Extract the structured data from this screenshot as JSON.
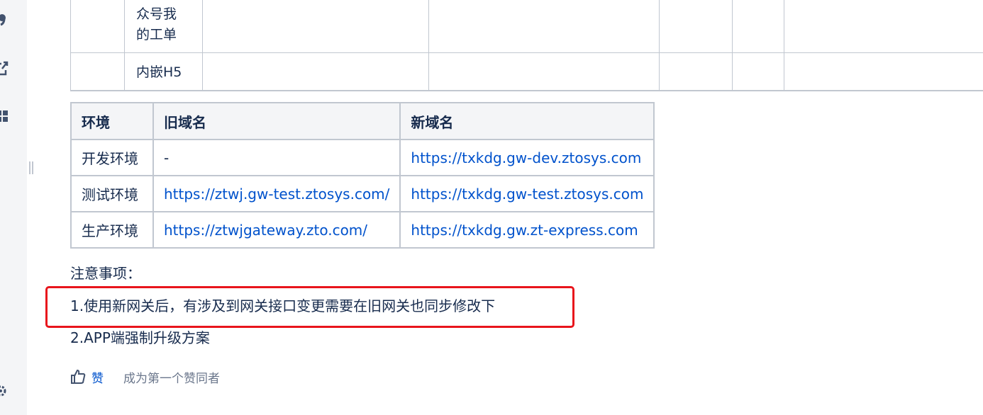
{
  "sidebar": {
    "icons": [
      "quote-icon",
      "share-icon",
      "apps-icon",
      "settings-icon"
    ]
  },
  "top_table": {
    "rows": [
      {
        "label": "众号我\n的工单"
      },
      {
        "label": "内嵌H5"
      }
    ]
  },
  "domain_table": {
    "headers": [
      "环境",
      "旧域名",
      "新域名"
    ],
    "rows": [
      {
        "env": "开发环境",
        "old": "-",
        "new": "https://txkdg.gw-dev.ztosys.com"
      },
      {
        "env": "测试环境",
        "old": "https://ztwj.gw-test.ztosys.com/",
        "new": "https://txkdg.gw-test.ztosys.com"
      },
      {
        "env": "生产环境",
        "old": "https://ztwjgateway.zto.com/",
        "new": "https://txkdg.gw.zt-express.com"
      }
    ]
  },
  "notes": {
    "title": "注意事项：",
    "items": [
      "1.使用新网关后，有涉及到网关接口变更需要在旧网关也同步修改下",
      "2.APP端强制升级方案"
    ]
  },
  "like_bar": {
    "like_label": "赞",
    "hint": "成为第一个赞同者"
  },
  "colors": {
    "link": "#0052cc",
    "highlight_border": "#e8151c",
    "table_border": "#c1c7d0",
    "header_bg": "#f4f5f7"
  }
}
